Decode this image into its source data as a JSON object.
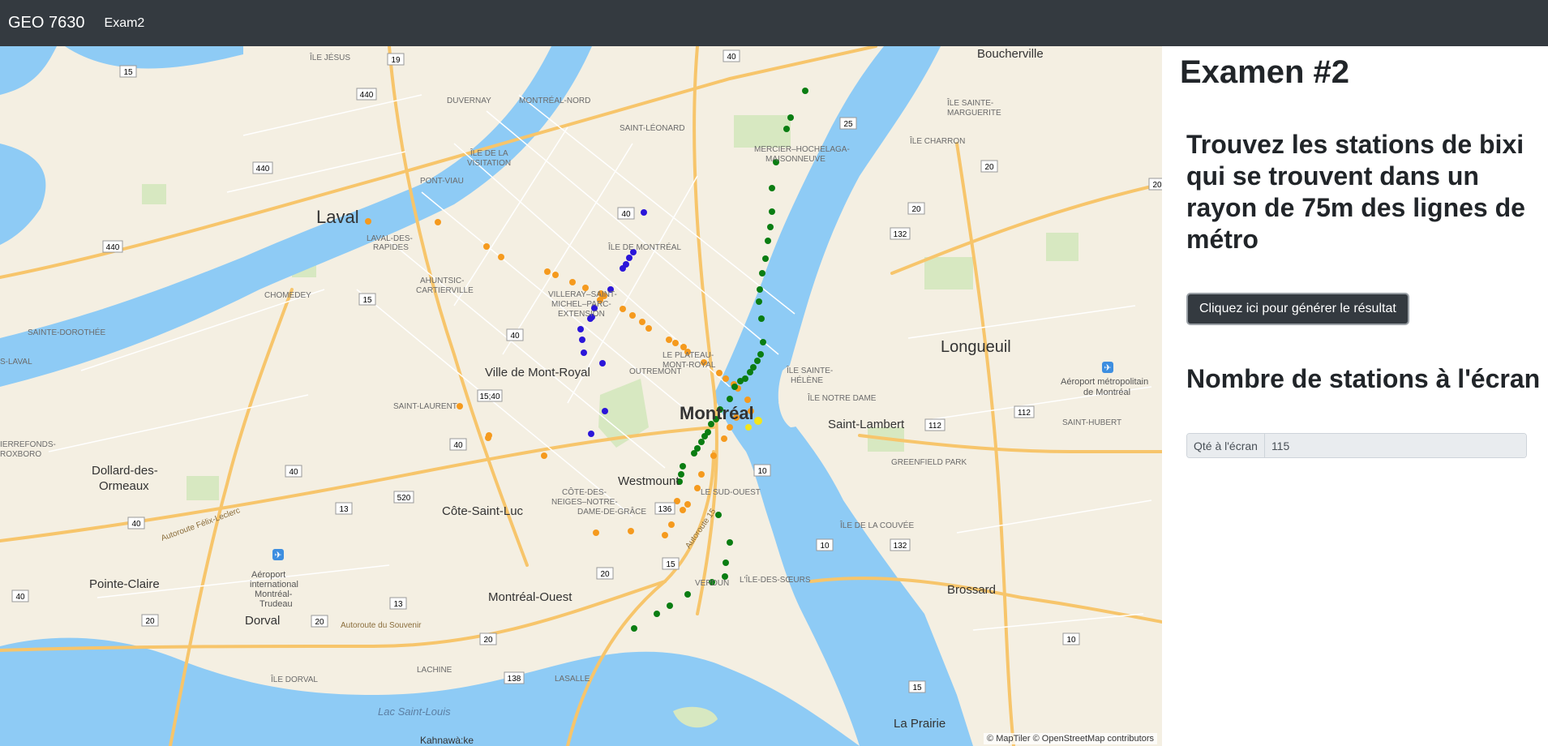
{
  "navbar": {
    "brand": "GEO 7630",
    "link": "Exam2"
  },
  "panel": {
    "title": "Examen #2",
    "task": "Trouvez les stations de bixi qui se trouvent dans un rayon de 75m des lignes de métro",
    "button_label": "Cliquez ici pour générer le résultat",
    "count_title": "Nombre de stations à l'écran",
    "input_label": "Qté à l'écran",
    "input_value": "115"
  },
  "map": {
    "attribution": "© MapTiler © OpenStreetMap contributors",
    "colors": {
      "water": "#8ecbf5",
      "land": "#f4efe2",
      "park": "#d7e8c1",
      "highway": "#f7c56b",
      "green_line": "#0a7d12",
      "orange_line": "#f59a1e",
      "blue_line": "#2b16d9",
      "yellow_line": "#f2e51b"
    },
    "cities": [
      "Laval",
      "Montréal",
      "Longueuil",
      "Ville de Mont-Royal",
      "Westmount",
      "Côte-Saint-Luc",
      "Dollard-des-Ormeaux",
      "Pointe-Claire",
      "Dorval",
      "Montréal-Ouest",
      "Saint-Lambert",
      "Brossard",
      "La Prairie",
      "Boucherville"
    ],
    "districts": [
      "ÎLE JÉSUS",
      "DUVERNAY",
      "MONTRÉAL-NORD",
      "SAINT-LÉONARD",
      "MERCIER–HOCHELAGA-MAISONNEUVE",
      "ÎLE DE LA VISITATION",
      "PONT-VIAU",
      "LAVAL-DES-RAPIDES",
      "ÎLE DE MONTRÉAL",
      "AHUNTSIC-CARTIERVILLE",
      "CHOMEDEY",
      "VILLERAY–SAINT-MICHEL–PARC-EXTENSION",
      "SAINTE-DOROTHÉE",
      "LE PLATEAU-MONT-ROYAL",
      "OUTREMONT",
      "SAINT-LAURENT",
      "ÎLE SAINTE-HÉLÈNE",
      "ÎLE NOTRE DAME",
      "LE SUD-OUEST",
      "CÔTE-DES-NEIGES–NOTRE-DAME-DE-GRÂCE",
      "ÎLE DE LA COUVÉE",
      "GREENFIELD PARK",
      "SAINT-HUBERT",
      "L'ÎLE-DES-SŒURS",
      "VERDUN",
      "LACHINE",
      "LASALLE",
      "ÎLE DORVAL",
      "ÎLE CHARRON",
      "ÎLE SAINTE-MARGUERITE",
      "Lac Saint-Louis",
      "Kahnawà:ke",
      "Aéroport métropolitain de Montréal",
      "Aéroport international Montréal-Trudeau"
    ],
    "route_shields": [
      "15",
      "19",
      "25",
      "40",
      "440",
      "20",
      "13",
      "520",
      "138",
      "112",
      "10",
      "132",
      "136"
    ],
    "road_labels": [
      "Autoroute Félix-Leclerc",
      "Autoroute 15",
      "Autoroute du Souvenir"
    ]
  }
}
